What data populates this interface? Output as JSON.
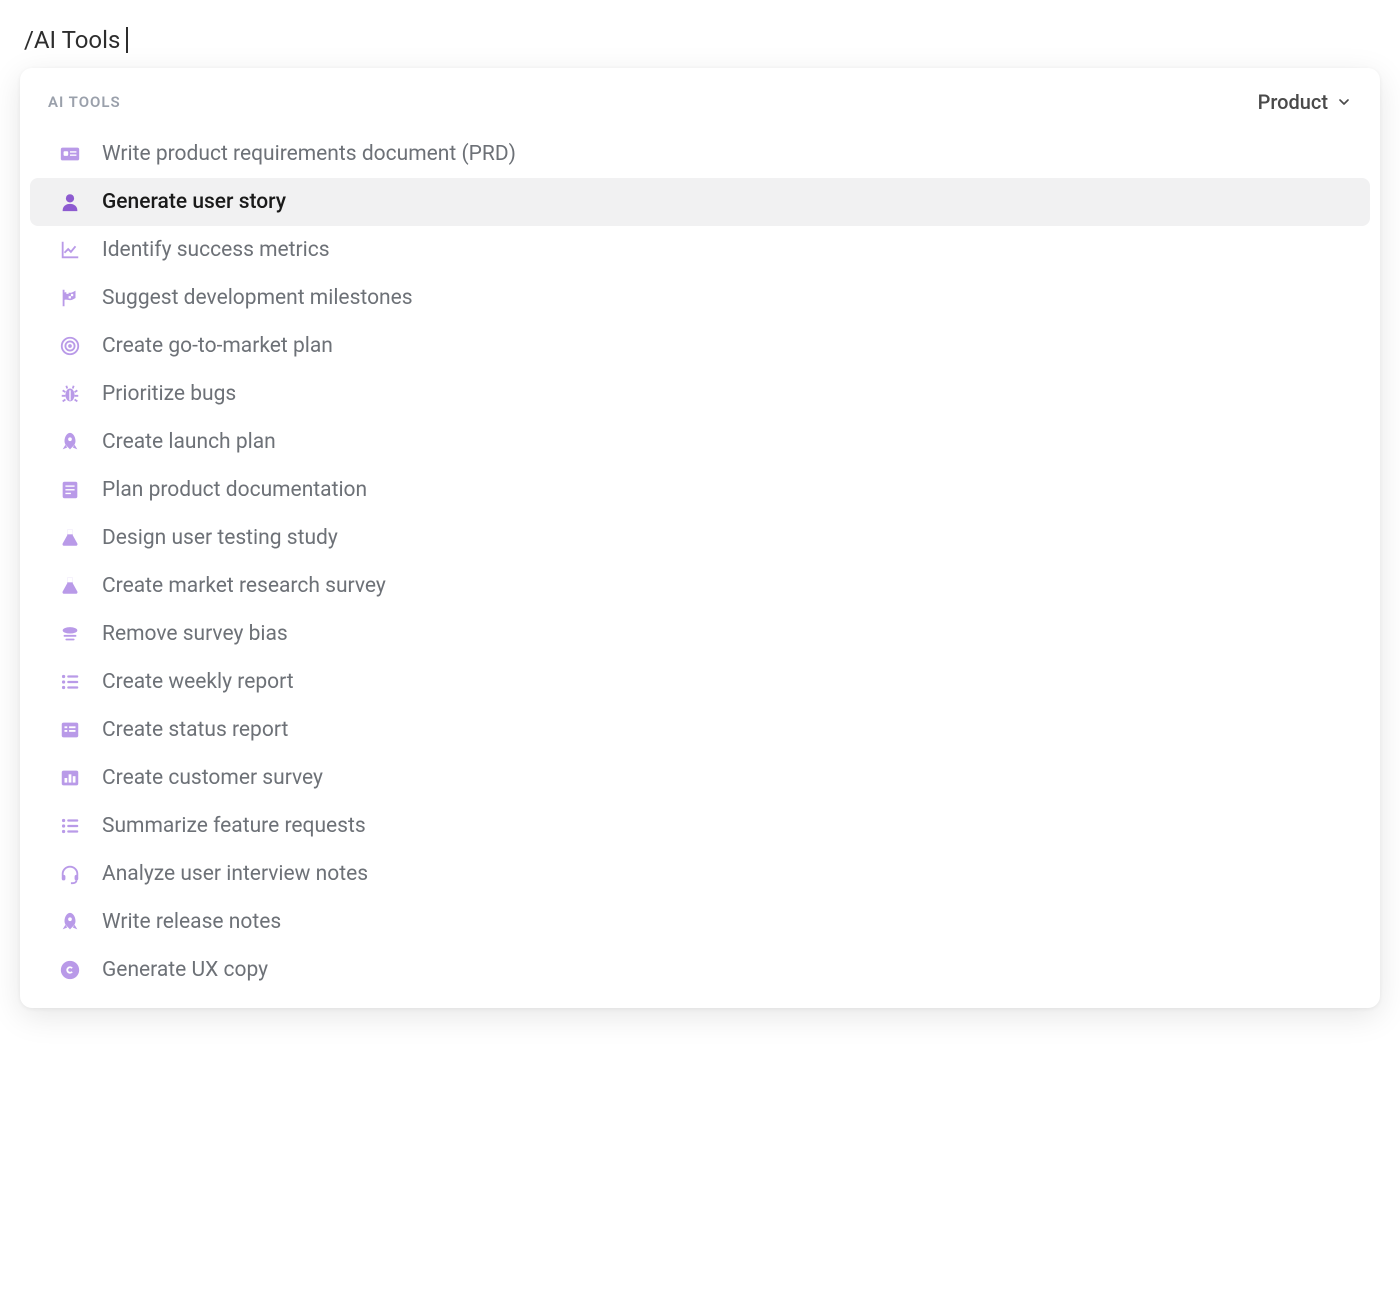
{
  "command": {
    "text": "/AI Tools"
  },
  "popup": {
    "section_title": "AI TOOLS",
    "filter": {
      "label": "Product"
    },
    "items": [
      {
        "label": "Write product requirements document (PRD)",
        "icon": "id-card-icon",
        "selected": false
      },
      {
        "label": "Generate user story",
        "icon": "user-icon",
        "selected": true
      },
      {
        "label": "Identify success metrics",
        "icon": "line-chart-icon",
        "selected": false
      },
      {
        "label": "Suggest development milestones",
        "icon": "flag-checkered-icon",
        "selected": false
      },
      {
        "label": "Create go-to-market plan",
        "icon": "target-icon",
        "selected": false
      },
      {
        "label": "Prioritize bugs",
        "icon": "bug-icon",
        "selected": false
      },
      {
        "label": "Create launch plan",
        "icon": "rocket-icon",
        "selected": false
      },
      {
        "label": "Plan product documentation",
        "icon": "book-icon",
        "selected": false
      },
      {
        "label": "Design user testing study",
        "icon": "flask-icon",
        "selected": false
      },
      {
        "label": "Create market research survey",
        "icon": "flask-icon",
        "selected": false
      },
      {
        "label": "Remove survey bias",
        "icon": "balance-icon",
        "selected": false
      },
      {
        "label": "Create weekly report",
        "icon": "list-icon",
        "selected": false
      },
      {
        "label": "Create status report",
        "icon": "form-icon",
        "selected": false
      },
      {
        "label": "Create customer survey",
        "icon": "bar-chart-icon",
        "selected": false
      },
      {
        "label": "Summarize feature requests",
        "icon": "list-icon",
        "selected": false
      },
      {
        "label": "Analyze user interview notes",
        "icon": "headset-icon",
        "selected": false
      },
      {
        "label": "Write release notes",
        "icon": "rocket-icon",
        "selected": false
      },
      {
        "label": "Generate UX copy",
        "icon": "copyright-icon",
        "selected": false
      }
    ]
  }
}
